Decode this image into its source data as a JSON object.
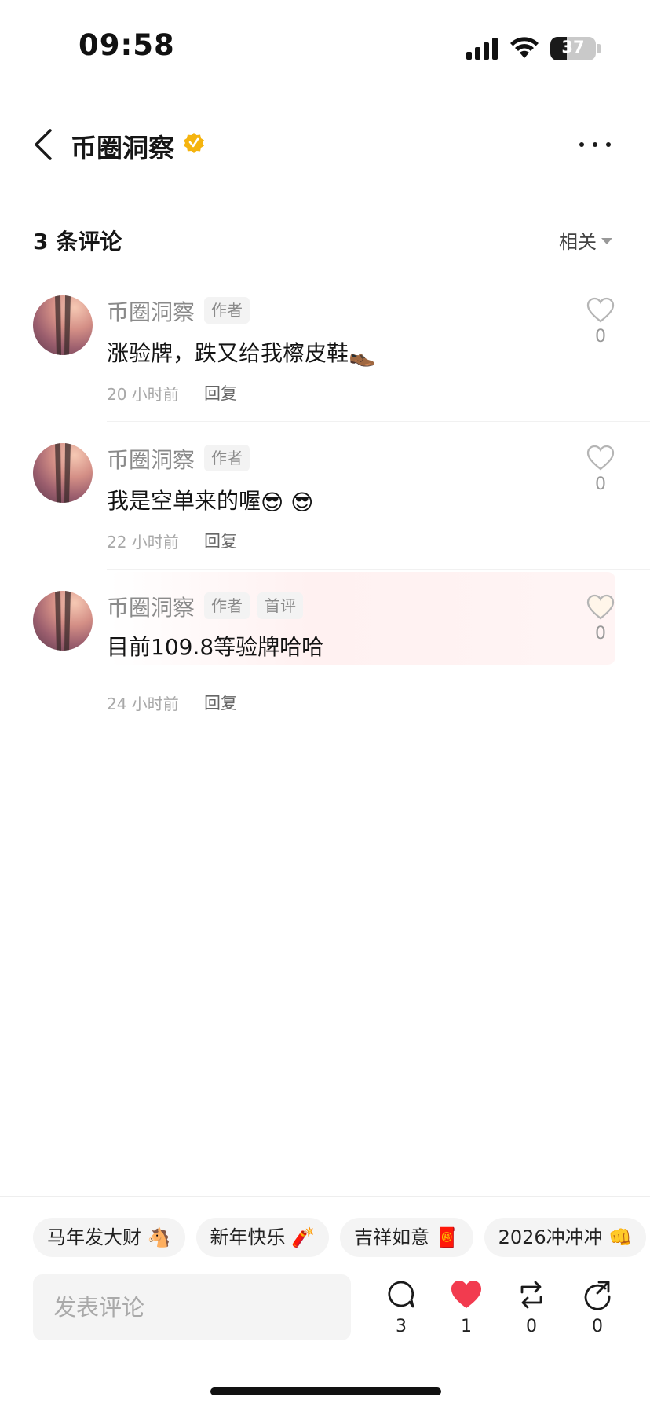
{
  "status_bar": {
    "time": "09:58",
    "battery": "37",
    "battery_level": 0.37
  },
  "nav": {
    "title": "币圈洞察",
    "back_icon": "chevron-left-icon",
    "badge_icon": "verified-badge-icon",
    "more_icon": "more-horizontal-icon"
  },
  "comments_header": {
    "count_label": "3 条评论",
    "sort_label": "相关"
  },
  "comments": [
    {
      "author": "币圈洞察",
      "tags": [
        "作者"
      ],
      "text": "涨验牌，跌又给我檫皮鞋",
      "emoji": "👞",
      "time": "20 小时前",
      "reply": "回复",
      "likes": "0"
    },
    {
      "author": "币圈洞察",
      "tags": [
        "作者"
      ],
      "text": "我是空单来的喔",
      "emoji": "😎 😎",
      "time": "22 小时前",
      "reply": "回复",
      "likes": "0"
    },
    {
      "author": "币圈洞察",
      "tags": [
        "作者",
        "首评"
      ],
      "text": "目前109.8等验牌哈哈",
      "emoji": "",
      "time": "24 小时前",
      "reply": "回复",
      "likes": "0"
    }
  ],
  "quick_replies": [
    {
      "label": "马年发大财",
      "emoji": "🐴"
    },
    {
      "label": "新年快乐",
      "emoji": "🧨"
    },
    {
      "label": "吉祥如意",
      "emoji": "🧧"
    },
    {
      "label": "2026冲冲冲",
      "emoji": "👊"
    }
  ],
  "composer": {
    "placeholder": "发表评论"
  },
  "actions": {
    "comments": "3",
    "likes": "1",
    "reposts": "0",
    "shares": "0"
  },
  "colors": {
    "like_active": "#f23b4f",
    "verified": "#f5b40f"
  }
}
